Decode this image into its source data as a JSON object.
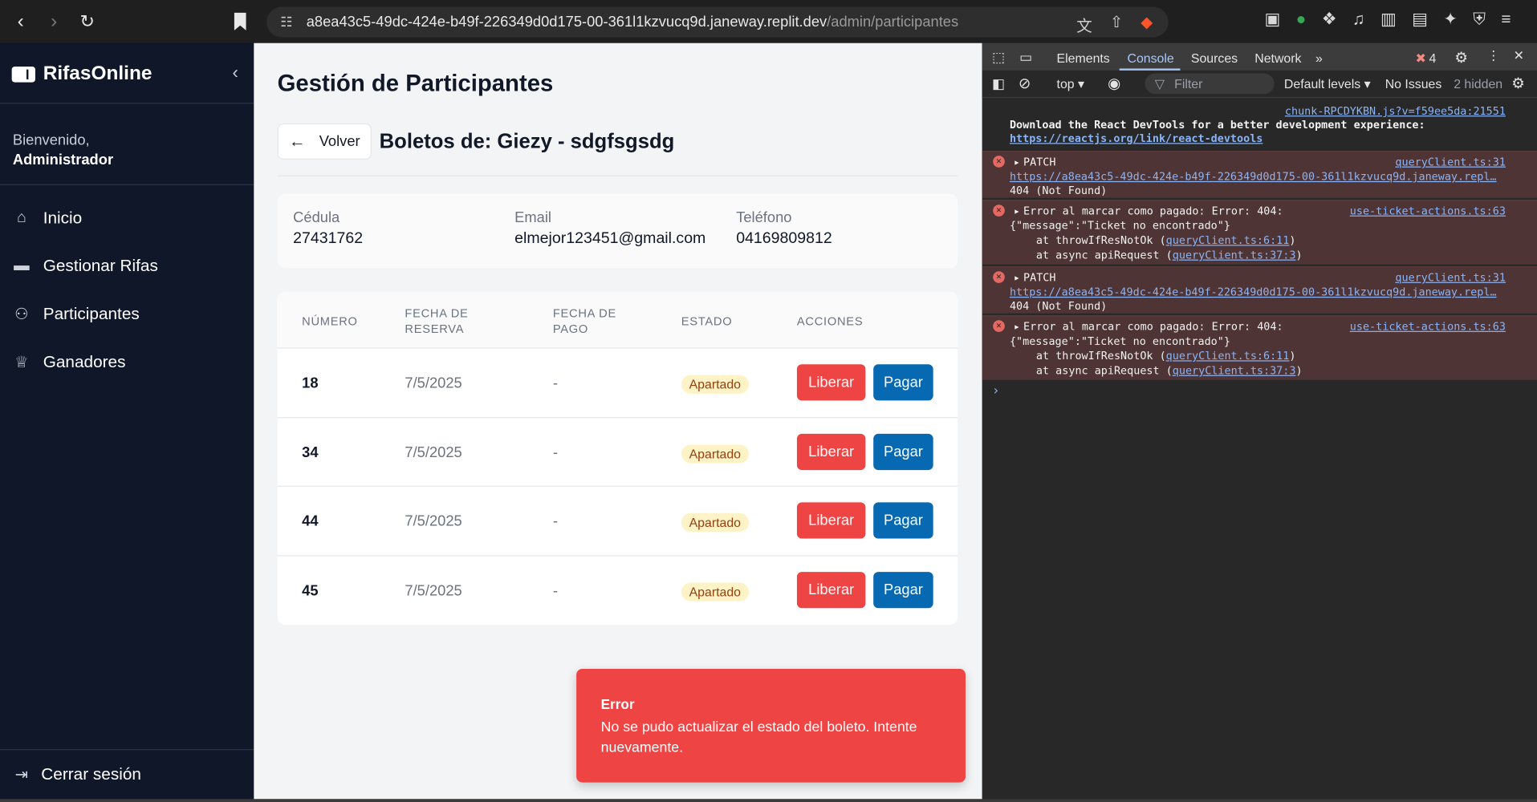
{
  "browser": {
    "url_host": "a8ea43c5-49dc-424e-b49f-226349d0d175-00-361l1kzvucq9d.janeway.replit.dev",
    "url_path": "/admin/participantes"
  },
  "sidebar": {
    "brand": "RifasOnline",
    "welcome": "Bienvenido,",
    "user": "Administrador",
    "items": [
      {
        "label": "Inicio"
      },
      {
        "label": "Gestionar Rifas"
      },
      {
        "label": "Participantes"
      },
      {
        "label": "Ganadores"
      }
    ],
    "logout": "Cerrar sesión"
  },
  "main": {
    "title": "Gestión de Participantes",
    "back": "Volver",
    "tickets_title": "Boletos de: Giezy - sdgfsgsdg",
    "info": {
      "cedula_label": "Cédula",
      "cedula": "27431762",
      "email_label": "Email",
      "email": "elmejor123451@gmail.com",
      "phone_label": "Teléfono",
      "phone": "04169809812"
    },
    "table": {
      "headers": [
        "Número",
        "Fecha de reserva",
        "Fecha de pago",
        "Estado",
        "Acciones"
      ],
      "rows": [
        {
          "numero": "18",
          "reserva": "7/5/2025",
          "pago": "-",
          "estado": "Apartado"
        },
        {
          "numero": "34",
          "reserva": "7/5/2025",
          "pago": "-",
          "estado": "Apartado"
        },
        {
          "numero": "44",
          "reserva": "7/5/2025",
          "pago": "-",
          "estado": "Apartado"
        },
        {
          "numero": "45",
          "reserva": "7/5/2025",
          "pago": "-",
          "estado": "Apartado"
        }
      ],
      "release_label": "Liberar",
      "pay_label": "Pagar"
    },
    "toast": {
      "title": "Error",
      "message": "No se pudo actualizar el estado del boleto. Intente nuevamente."
    }
  },
  "devtools": {
    "tabs": [
      "Elements",
      "Console",
      "Sources",
      "Network"
    ],
    "error_count": "4",
    "context": "top",
    "filter": "Filter",
    "levels": "Default levels",
    "issues": "No Issues",
    "hidden": "2 hidden",
    "logs": {
      "chunk_src": "chunk-RPCDYKBN.js?v=f59ee5da:21551",
      "react_msg": "Download the React DevTools for a better development experience:",
      "react_link": "https://reactjs.org/link/react-devtools",
      "patch_label": "PATCH",
      "patch_src": "queryClient.ts:31",
      "patch_url": "https://a8ea43c5-49dc-424e-b49f-226349d0d175-00-361l1kzvucq9d.janeway.repl…",
      "not_found": "404 (Not Found)",
      "err_msg": "Error al marcar como pagado: Error: 404:",
      "err_src": "use-ticket-actions.ts:63",
      "err_json": "{\"message\":\"Ticket no encontrado\"}",
      "err_at1_pre": "at throwIfResNotOk (",
      "err_at1_link": "queryClient.ts:6:11",
      "err_at2_pre": "at async apiRequest (",
      "err_at2_link": "queryClient.ts:37:3"
    }
  }
}
